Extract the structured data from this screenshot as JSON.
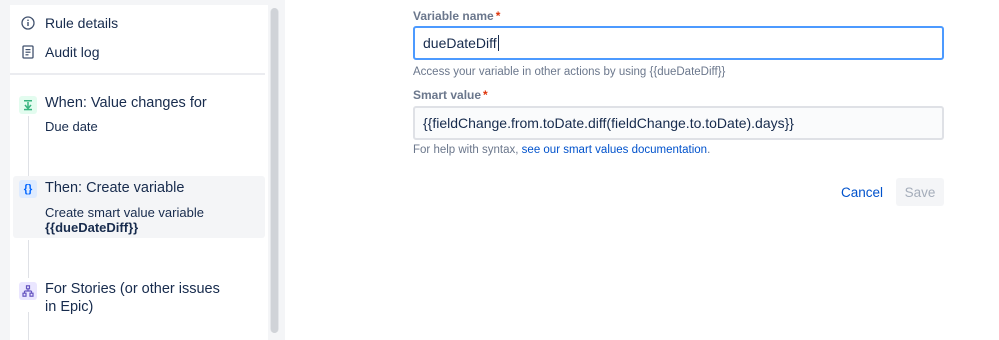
{
  "sidebar": {
    "nav": [
      {
        "label": "Rule details",
        "icon": "info-icon"
      },
      {
        "label": "Audit log",
        "icon": "document-icon"
      }
    ],
    "steps": [
      {
        "title": "When: Value changes for",
        "subtitle": "Due date",
        "icon": "trigger-icon",
        "icon_color": "#36b37e"
      },
      {
        "title": "Then: Create variable",
        "subtitle_prefix": "Create smart value variable",
        "subtitle_bold": "{{dueDateDiff}}",
        "icon": "braces-icon",
        "icon_color": "#0065ff"
      },
      {
        "title": "For Stories (or other issues",
        "title_line2": "in Epic)",
        "icon": "branch-icon",
        "icon_color": "#6554c0"
      }
    ]
  },
  "form": {
    "variable_name": {
      "label": "Variable name",
      "required_mark": "*",
      "value": "dueDateDiff",
      "help": "Access your variable in other actions by using {{dueDateDiff}}"
    },
    "smart_value": {
      "label": "Smart value",
      "required_mark": "*",
      "value": "{{fieldChange.from.toDate.diff(fieldChange.to.toDate).days}}",
      "help_prefix": "For help with syntax,",
      "help_link": "see our smart values documentation",
      "help_suffix": "."
    },
    "cancel_label": "Cancel",
    "save_label": "Save"
  }
}
